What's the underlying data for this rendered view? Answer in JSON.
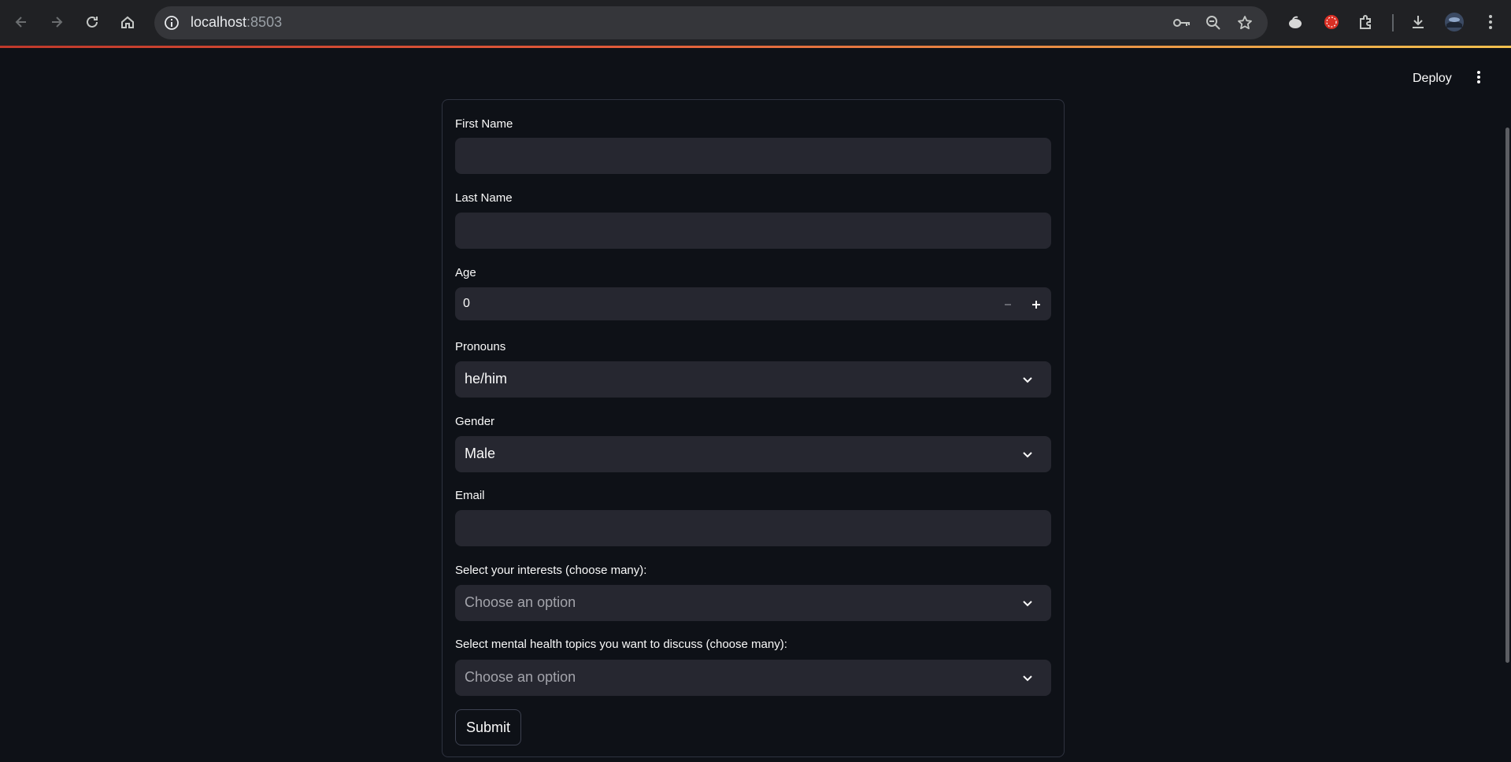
{
  "browser": {
    "url_host": "localhost",
    "url_port": ":8503"
  },
  "header": {
    "deploy_label": "Deploy"
  },
  "form": {
    "first_name": {
      "label": "First Name",
      "value": ""
    },
    "last_name": {
      "label": "Last Name",
      "value": ""
    },
    "age": {
      "label": "Age",
      "value": "0"
    },
    "pronouns": {
      "label": "Pronouns",
      "value": "he/him"
    },
    "gender": {
      "label": "Gender",
      "value": "Male"
    },
    "email": {
      "label": "Email",
      "value": ""
    },
    "interests": {
      "label": "Select your interests (choose many):",
      "placeholder": "Choose an option"
    },
    "topics": {
      "label": "Select mental health topics you want to discuss (choose many):",
      "placeholder": "Choose an option"
    },
    "submit_label": "Submit"
  }
}
